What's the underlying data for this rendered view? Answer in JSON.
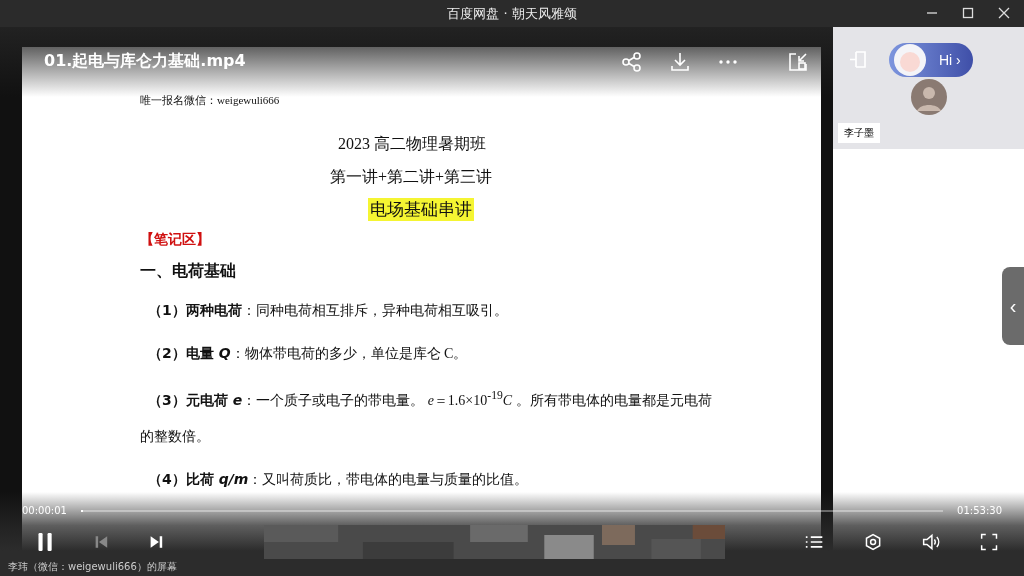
{
  "window": {
    "title": "百度网盘 · 朝天风雅颂"
  },
  "video": {
    "title": "01.起电与库仑力基础.mp4"
  },
  "document": {
    "header": "唯一报名微信：weigewuli666",
    "course": "2023 高二物理暑期班",
    "lectures": "第一讲+第二讲+第三讲",
    "topic": "电场基础串讲",
    "notes_label": "【笔记区】",
    "section": "一、电荷基础",
    "items": [
      {
        "label": "（1）两种电荷",
        "text": "：同种电荷相互排斥，异种电荷相互吸引。"
      },
      {
        "label": "（2）电量 *Q*",
        "text": "：物体带电荷的多少，单位是库仑 C。"
      },
      {
        "label": "（3）元电荷  *e*",
        "text": "：一个质子或电子的带电量。 *e*＝1.6×10$^{-19}$*C* 。所有带电体的电量都是元电荷的整数倍。"
      },
      {
        "label": "（4）比荷 *q/m*",
        "text": "：又叫荷质比，带电体的电量与质量的比值。"
      }
    ]
  },
  "side_panel": {
    "greeting": "Hi ›",
    "participant": "李子墨",
    "collapse": "‹"
  },
  "player": {
    "current_time": "00:00:01",
    "duration": "01:53:30",
    "level": 0.002,
    "prev_disabled": true,
    "screen_owner": "李玮（微信：weigewuli666）的屏幕"
  }
}
